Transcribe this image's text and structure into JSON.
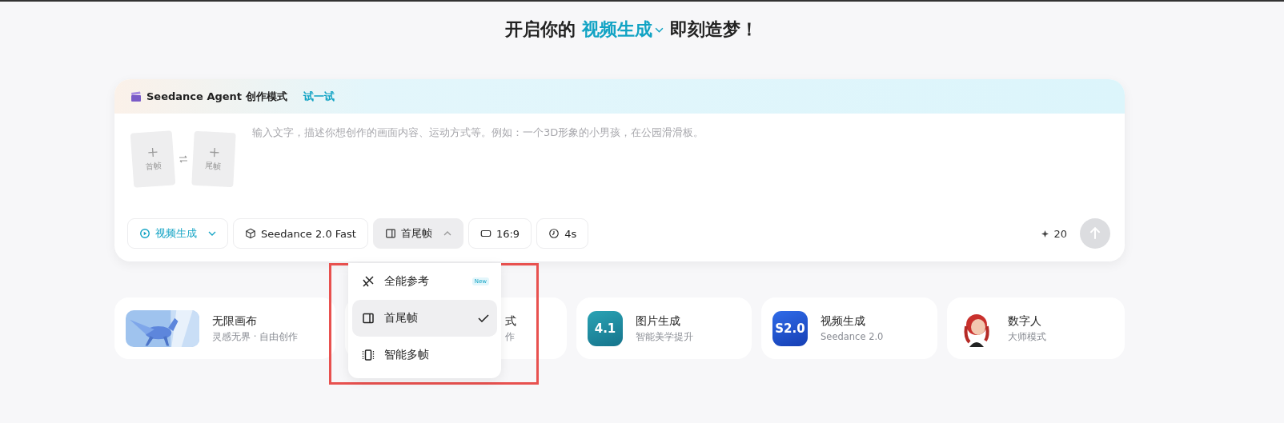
{
  "headline": {
    "prefix": "开启你的",
    "mode": "视频生成",
    "suffix": "即刻造梦！"
  },
  "composer": {
    "banner": {
      "title": "Seedance Agent 创作模式",
      "link": "试一试"
    },
    "frames": [
      {
        "label": "首帧"
      },
      {
        "label": "尾帧"
      }
    ],
    "prompt": {
      "placeholder": "输入文字，描述你想创作的画面内容、运动方式等。例如：一个3D形象的小男孩，在公园滑滑板。"
    },
    "toolbar": [
      {
        "kind": "mode",
        "label": "视频生成",
        "expanded": false
      },
      {
        "kind": "model",
        "label": "Seedance 2.0 Fast"
      },
      {
        "kind": "frames",
        "label": "首尾帧",
        "expanded": true
      },
      {
        "kind": "ratio",
        "label": "16:9"
      },
      {
        "kind": "duration",
        "label": "4s"
      }
    ],
    "credits": "20",
    "send": {
      "disabled": true
    }
  },
  "menu": [
    {
      "kind": "reference",
      "label": "全能参考",
      "badge": "New",
      "selected": false
    },
    {
      "kind": "frames",
      "label": "首尾帧",
      "selected": true
    },
    {
      "kind": "multi",
      "label": "智能多帧",
      "selected": false
    }
  ],
  "cards": [
    {
      "kind": "picture",
      "title": "无限画布",
      "subtitle": "灵感无界 · 自由创作"
    },
    {
      "kind": "partial",
      "title": "式",
      "subtitle": "作"
    },
    {
      "tile": "4.1",
      "title": "图片生成",
      "subtitle": "智能美学提升"
    },
    {
      "kind": "video",
      "tile": "S2.0",
      "title": "视频生成",
      "subtitle": "Seedance 2.0"
    },
    {
      "kind": "avatar",
      "title": "数字人",
      "subtitle": "大师模式"
    }
  ]
}
